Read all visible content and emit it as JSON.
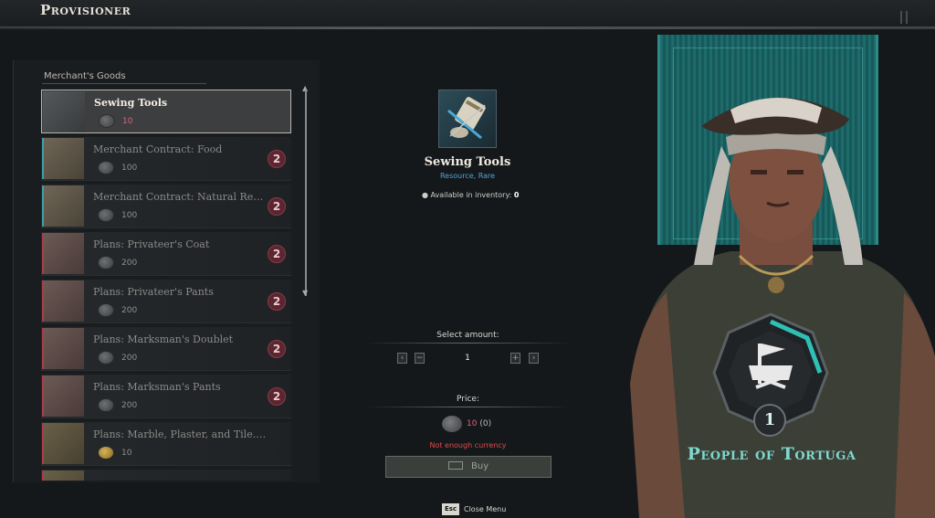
{
  "header": {
    "title": "Provisioner"
  },
  "list": {
    "section_label": "Merchant's Goods",
    "items": [
      {
        "name": "Sewing Tools",
        "price": "10",
        "selected": true,
        "thumb": "tools",
        "coin": "silver"
      },
      {
        "name": "Merchant Contract: Food",
        "price": "100",
        "badge": "2",
        "thumb": "doc",
        "coin": "silver"
      },
      {
        "name": "Merchant Contract: Natural Resou...",
        "price": "100",
        "badge": "2",
        "thumb": "doc",
        "coin": "silver"
      },
      {
        "name": "Plans: Privateer's Coat",
        "price": "200",
        "badge": "2",
        "thumb": "plan",
        "coin": "silver"
      },
      {
        "name": "Plans: Privateer's Pants",
        "price": "200",
        "badge": "2",
        "thumb": "plan",
        "coin": "silver"
      },
      {
        "name": "Plans: Marksman's Doublet",
        "price": "200",
        "badge": "2",
        "thumb": "plan",
        "coin": "silver"
      },
      {
        "name": "Plans: Marksman's Pants",
        "price": "200",
        "badge": "2",
        "thumb": "plan",
        "coin": "silver"
      },
      {
        "name": "Plans: Marble, Plaster, and Tile. Base set.",
        "price": "10",
        "thumb": "plan2",
        "coin": "gold"
      },
      {
        "name": "",
        "price": "",
        "thumb": "plan2",
        "coin": "none"
      }
    ]
  },
  "detail": {
    "name": "Sewing Tools",
    "subtitle": "Resource, Rare",
    "inventory_label": "Available in inventory:",
    "inventory_value": "0"
  },
  "amount": {
    "label": "Select amount:",
    "value": "1",
    "min_label": "‹",
    "minus_label": "−",
    "plus_label": "+",
    "max_label": "›"
  },
  "price": {
    "label": "Price:",
    "value": "10",
    "owned": "(0)",
    "warning": "Not enough currency"
  },
  "buy_button": {
    "label": "Buy"
  },
  "footer": {
    "key": "Esc",
    "label": "Close Menu"
  },
  "faction": {
    "name": "People of Tortuga",
    "level": "1"
  },
  "colors": {
    "accent": "#2aa8a0",
    "warning": "#e04a4a",
    "price": "#e0607a",
    "badge": "#5a2630"
  }
}
